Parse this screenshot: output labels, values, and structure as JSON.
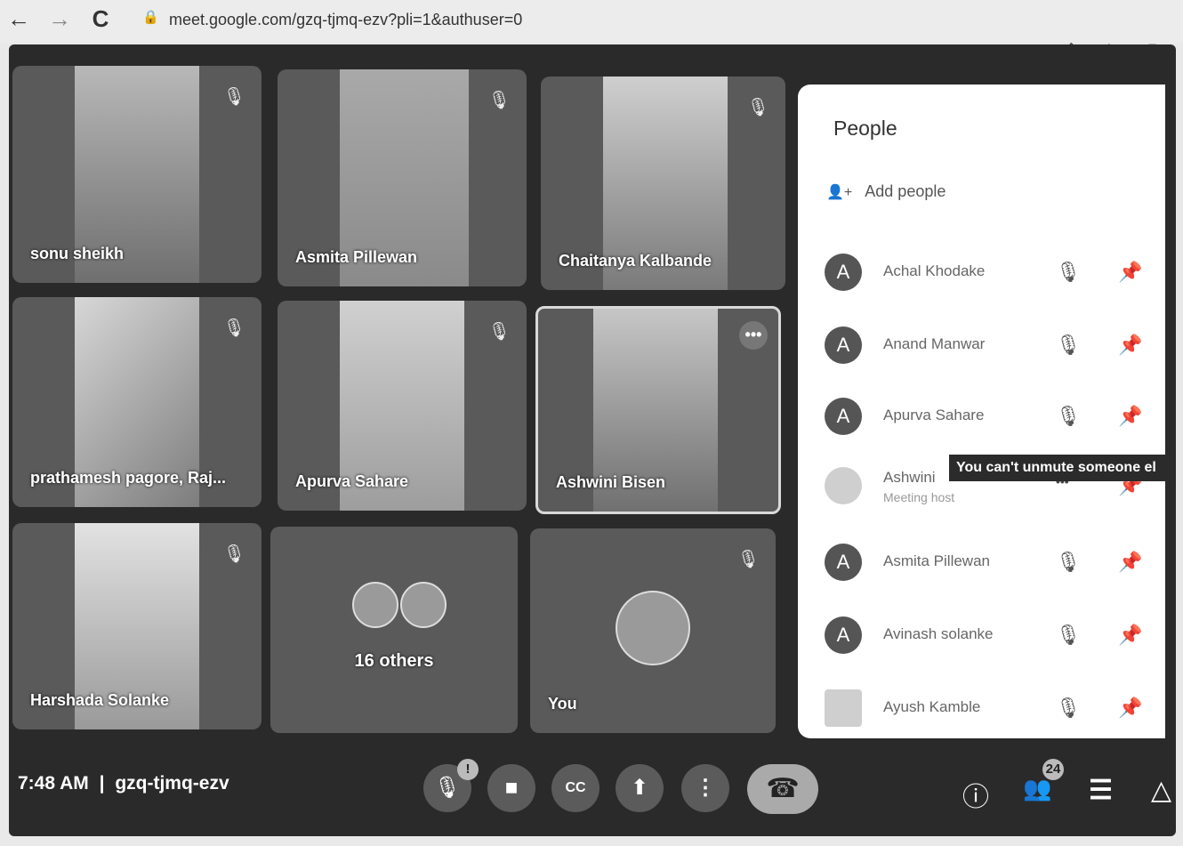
{
  "browser": {
    "url": "meet.google.com/gzq-tjmq-ezv?pli=1&authuser=0",
    "back_icon": "←",
    "forward_icon": "→",
    "reload_icon": "C",
    "lock_icon": "🔒",
    "share_icon": "⇪",
    "star_icon": "☆",
    "sidepanel_icon": "▯"
  },
  "tiles": [
    {
      "name": "sonu sheikh"
    },
    {
      "name": "Asmita Pillewan"
    },
    {
      "name": "Chaitanya Kalbande"
    },
    {
      "name": "prathamesh pagore, Raj..."
    },
    {
      "name": "Apurva Sahare"
    },
    {
      "name": "Ashwini Bisen"
    },
    {
      "name": "Harshada Solanke"
    },
    {
      "name": "16 others"
    },
    {
      "name": "You"
    }
  ],
  "icons": {
    "mic_off": "🎙",
    "more": "•••"
  },
  "bottom": {
    "time": "7:48 AM",
    "separator": "|",
    "meeting_code": "gzq-tjmq-ezv",
    "mic_badge": "!",
    "participants_count": "24",
    "icons": {
      "mic": "🎙",
      "camera": "■",
      "captions": "CC",
      "present": "⬆",
      "more": "⋮",
      "hangup": "☎",
      "info": "ⓘ",
      "people": "👥",
      "chat": "☰",
      "activities": "△"
    }
  },
  "people_panel": {
    "title": "People",
    "add_people": "Add people",
    "add_icon": "👤+",
    "participants": [
      {
        "initial": "A",
        "name": "Achal Khodake",
        "sub": ""
      },
      {
        "initial": "A",
        "name": "Anand Manwar",
        "sub": ""
      },
      {
        "initial": "A",
        "name": "Apurva Sahare",
        "sub": ""
      },
      {
        "initial": "",
        "name": "Ashwini",
        "sub": "Meeting host"
      },
      {
        "initial": "A",
        "name": "Asmita Pillewan",
        "sub": ""
      },
      {
        "initial": "A",
        "name": "Avinash solanke",
        "sub": ""
      },
      {
        "initial": "",
        "name": "Ayush Kamble",
        "sub": ""
      }
    ],
    "mic_icon": "🎙",
    "pin_icon": "📌",
    "more_icon": "•••"
  },
  "tooltip": "You can't unmute someone el"
}
